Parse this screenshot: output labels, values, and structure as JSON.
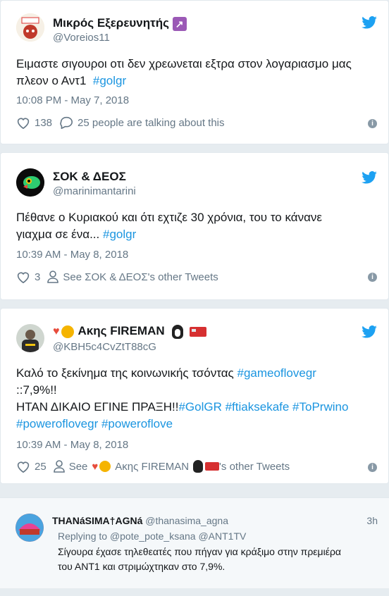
{
  "tweets": [
    {
      "name": "Μικρός Εξερευνητής",
      "handle": "@Voreios11",
      "line1": "Ειμαστε σιγουροι οτι δεν χρεωνεται εξτρα στον λογαριασμο μας",
      "line2": "πλεον ο Αντ1",
      "hashtag": "#golgr",
      "time": "10:08 PM - May 7, 2018",
      "likes": "138",
      "replies_text": "25 people are talking about this"
    },
    {
      "name": "ΣΟΚ & ΔΕΟΣ",
      "handle": "@marinimantarini",
      "line1": "Πέθανε ο Κυριακού και ότι εχτιζε 30 χρόνια, του το κάνανε",
      "line2": "γιαχμα σε ένα...",
      "hashtag": "#golgr",
      "time": "10:39 AM - May 8, 2018",
      "likes": "3",
      "see_text": "See ΣΟΚ & ΔΕΟΣ's other Tweets"
    },
    {
      "name": "Ακης FIREMAN",
      "handle": "@KBH5c4CvZtT88cG",
      "line1": "Καλό το ξεκίνημα της κοινωνικής τσόντας",
      "tag1": "#gameoflovegr",
      "line2": "::7,9%!!",
      "line3": "ΗΤΑΝ ΔΙΚΑΙΟ ΕΓΙΝΕ ΠΡΑΞΗ!!",
      "tags3": "#GolGR #ftiaksekafe #ToPrwino",
      "tags4": "#poweroflovegr #poweroflove",
      "time": "10:39 AM - May 8, 2018",
      "likes": "25",
      "see_prefix": "See",
      "see_suffix": "'s other Tweets"
    }
  ],
  "reply": {
    "name": "THANáSIMA†AGNá",
    "handle": "@thanasima_agna",
    "age": "3h",
    "replying_prefix": "Replying to",
    "replying_users": "@pote_pote_ksana @ANT1TV",
    "line1": "Σίγουρα έχασε τηλεθεατές που πήγαν για κράξιμο στην πρεμιέρα",
    "line2": "του ΑΝΤ1 και στριμώχτηκαν στο 7,9%."
  },
  "colors": {
    "accent": "#1b95e0",
    "twitter": "#1da1f2",
    "muted": "#657786"
  }
}
